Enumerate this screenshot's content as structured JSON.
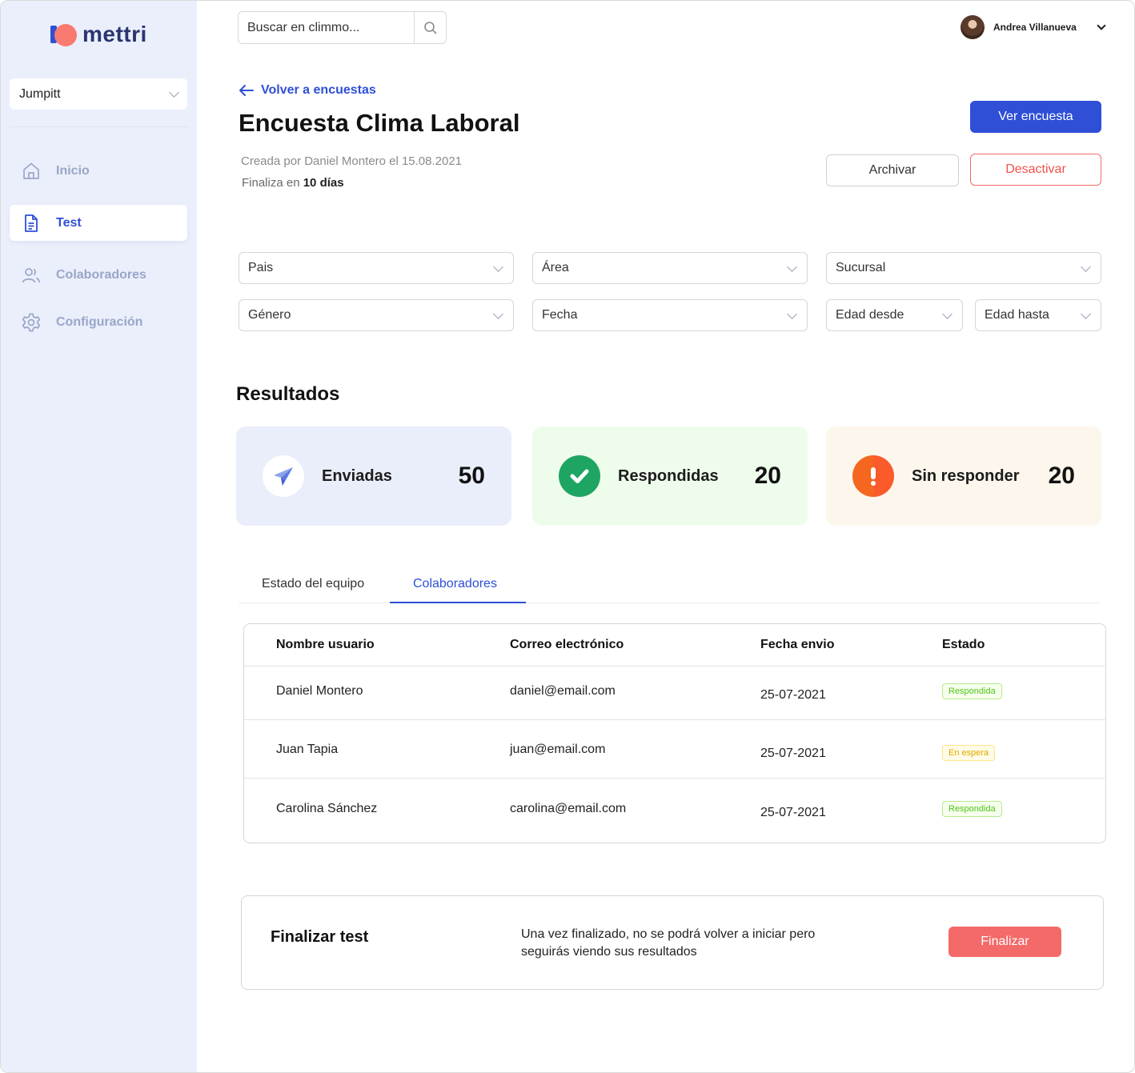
{
  "app": {
    "logo_text": "mettri"
  },
  "sidebar": {
    "workspace": "Jumpitt",
    "items": [
      {
        "label": "Inicio",
        "icon": "home-icon",
        "active": false
      },
      {
        "label": "Test",
        "icon": "document-icon",
        "active": true
      },
      {
        "label": "Colaboradores",
        "icon": "users-icon",
        "active": false
      },
      {
        "label": "Configuración",
        "icon": "gear-icon",
        "active": false
      }
    ]
  },
  "topbar": {
    "search_placeholder": "Buscar en climmo...",
    "user_name": "Andrea Villanueva"
  },
  "header": {
    "back_label": "Volver a encuestas",
    "title": "Encuesta Clima Laboral",
    "created": "Creada por Daniel Montero el 15.08.2021",
    "ends_prefix": "Finaliza en ",
    "ends_value": "10 días",
    "view_button": "Ver encuesta",
    "archive_button": "Archivar",
    "deactivate_button": "Desactivar"
  },
  "filters": {
    "pais": "Pais",
    "area": "Área",
    "sucursal": "Sucursal",
    "genero": "Género",
    "fecha": "Fecha",
    "edad_desde": "Edad desde",
    "edad_hasta": "Edad hasta"
  },
  "results": {
    "title": "Resultados",
    "cards": [
      {
        "label": "Enviadas",
        "value": "50",
        "icon": "paper-plane-icon",
        "bg": "#eaeefb"
      },
      {
        "label": "Respondidas",
        "value": "20",
        "icon": "check-circle-icon",
        "bg": "#eefcec"
      },
      {
        "label": "Sin responder",
        "value": "20",
        "icon": "alert-circle-icon",
        "bg": "#fdf6ec"
      }
    ]
  },
  "tabs": [
    {
      "label": "Estado del equipo",
      "active": false
    },
    {
      "label": "Colaboradores",
      "active": true
    }
  ],
  "table": {
    "columns": [
      "Nombre usuario",
      "Correo electrónico",
      "Fecha envio",
      "Estado"
    ],
    "rows": [
      {
        "name": "Daniel Montero",
        "email": "daniel@email.com",
        "date": "25-07-2021",
        "status": "Respondida"
      },
      {
        "name": "Juan Tapia",
        "email": "juan@email.com",
        "date": "25-07-2021",
        "status": "En espera"
      },
      {
        "name": "Carolina Sánchez",
        "email": "carolina@email.com",
        "date": "25-07-2021",
        "status": "Respondida"
      }
    ]
  },
  "finalize": {
    "title": "Finalizar test",
    "description": "Una vez finalizado, no se podrá volver a iniciar pero seguirás viendo sus resultados",
    "button": "Finalizar"
  },
  "colors": {
    "accent": "#2e4fd6",
    "danger": "#f0524c",
    "finalize": "#f36a69",
    "sidebar_bg": "#ebeffb"
  }
}
